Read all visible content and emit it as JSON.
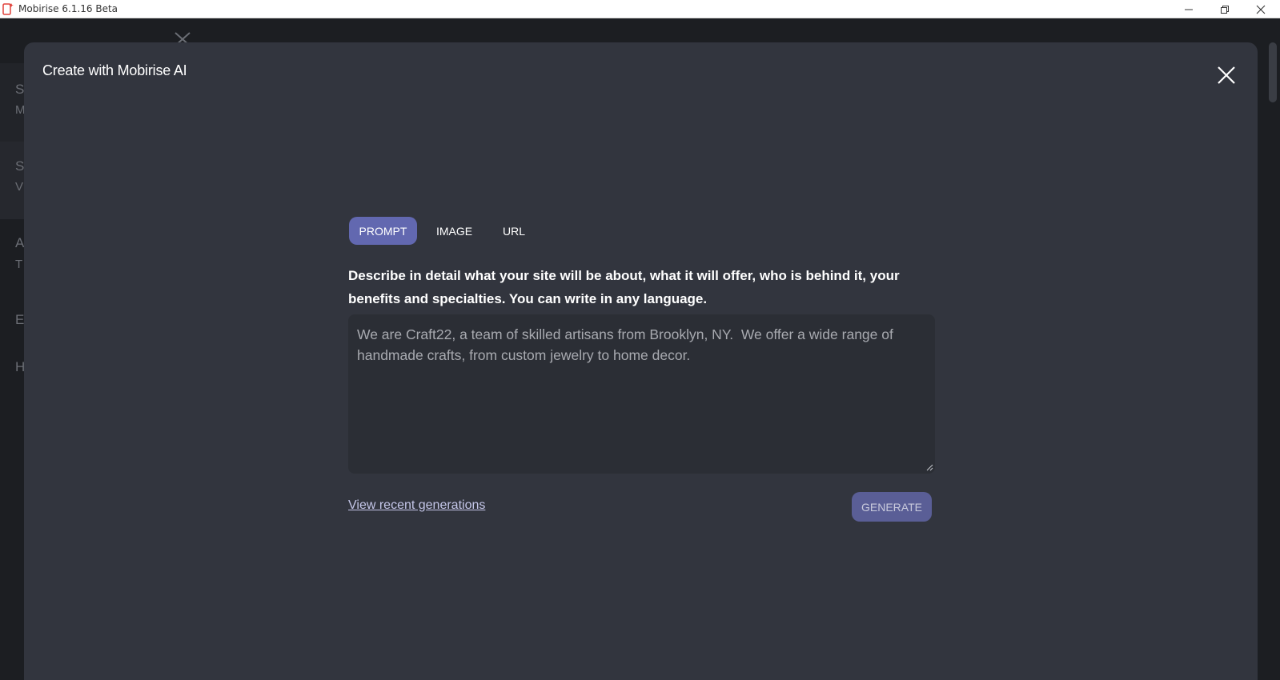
{
  "window": {
    "title": "Mobirise 6.1.16 Beta"
  },
  "background": {
    "sidebar_letters": [
      "S",
      "M",
      "S",
      "V",
      "A",
      "T",
      "E",
      "H"
    ]
  },
  "modal": {
    "title": "Create with Mobirise AI",
    "tabs": [
      {
        "label": "PROMPT",
        "active": true
      },
      {
        "label": "IMAGE",
        "active": false
      },
      {
        "label": "URL",
        "active": false
      }
    ],
    "description": "Describe in detail what your site will be about, what it will offer, who is behind it, your benefits and specialties. You can write in any language.",
    "prompt": {
      "placeholder": "We are Craft22, a team of skilled artisans from Brooklyn, NY.  We offer a wide range of handmade crafts, from custom jewelry to home decor.",
      "value": ""
    },
    "recent_link": "View recent generations",
    "generate_label": "GENERATE"
  },
  "colors": {
    "accent": "#6268b0",
    "modal_bg": "#32353e",
    "input_bg": "#2b2e35"
  }
}
